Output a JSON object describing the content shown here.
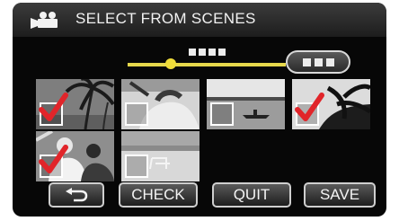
{
  "header": {
    "title": "SELECT FROM SCENES",
    "icon": "movie-camera-icon"
  },
  "timeline": {
    "position_fraction": 0.27
  },
  "menu_button": {
    "icon": "menu-dots-icon"
  },
  "thumbnails": [
    {
      "checked": true
    },
    {
      "checked": false
    },
    {
      "checked": false
    },
    {
      "checked": true
    },
    {
      "checked": true
    },
    {
      "checked": false
    }
  ],
  "buttons": {
    "back_icon": "return-arrow-icon",
    "check": "CHECK",
    "quit": "QUIT",
    "save": "SAVE"
  },
  "colors": {
    "checkmark": "#e1252a",
    "timeline_fill": "#e6d84b",
    "knob": "#f0dd3a"
  }
}
